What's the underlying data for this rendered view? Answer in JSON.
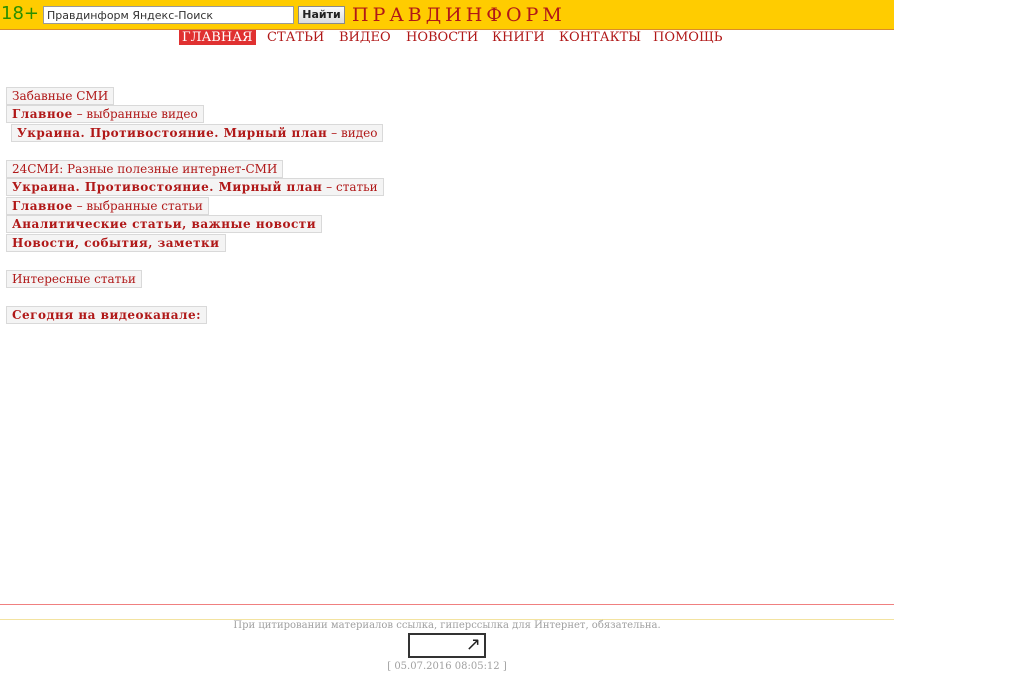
{
  "header": {
    "age_rating": "18+",
    "search_value": "Правдинформ Яндекс-Поиск",
    "search_button": "Найти",
    "site_title": "ПРАВДИНФОРМ",
    "brand_color": "#ffcc00",
    "accent_color": "#b01818"
  },
  "nav": [
    {
      "label": "ГЛАВНАЯ",
      "active": true
    },
    {
      "label": "СТАТЬИ"
    },
    {
      "label": "ВИДЕО"
    },
    {
      "label": "НОВОСТИ"
    },
    {
      "label": "КНИГИ"
    },
    {
      "label": "КОНТАКТЫ"
    },
    {
      "label": "ПОМОЩЬ"
    }
  ],
  "groups": {
    "video": {
      "title": "Забавные СМИ",
      "main": {
        "bold": "Главное",
        "sub": " – выбранные видео"
      },
      "ukraine": {
        "bold": "Украина. Противостояние. Мирный план",
        "sub": " – видео"
      }
    },
    "media": {
      "title": "24СМИ: Разные полезные интернет-СМИ",
      "ukraine": {
        "bold": "Украина. Противостояние. Мирный план",
        "sub": " – статьи"
      },
      "main": {
        "bold": "Главное",
        "sub": " – выбранные статьи"
      },
      "analytics": "Аналитические статьи, важные новости",
      "news": "Новости, события, заметки"
    },
    "interesting": "Интересные статьи",
    "today": "Сегодня на видеоканале:"
  },
  "footer": {
    "note": "При цитировании материалов ссылка, гиперссылка для Интернет, обязательна.",
    "counter_icon": "arrow-out-icon",
    "timestamp": "[ 05.07.2016 08:05:12 ]"
  }
}
